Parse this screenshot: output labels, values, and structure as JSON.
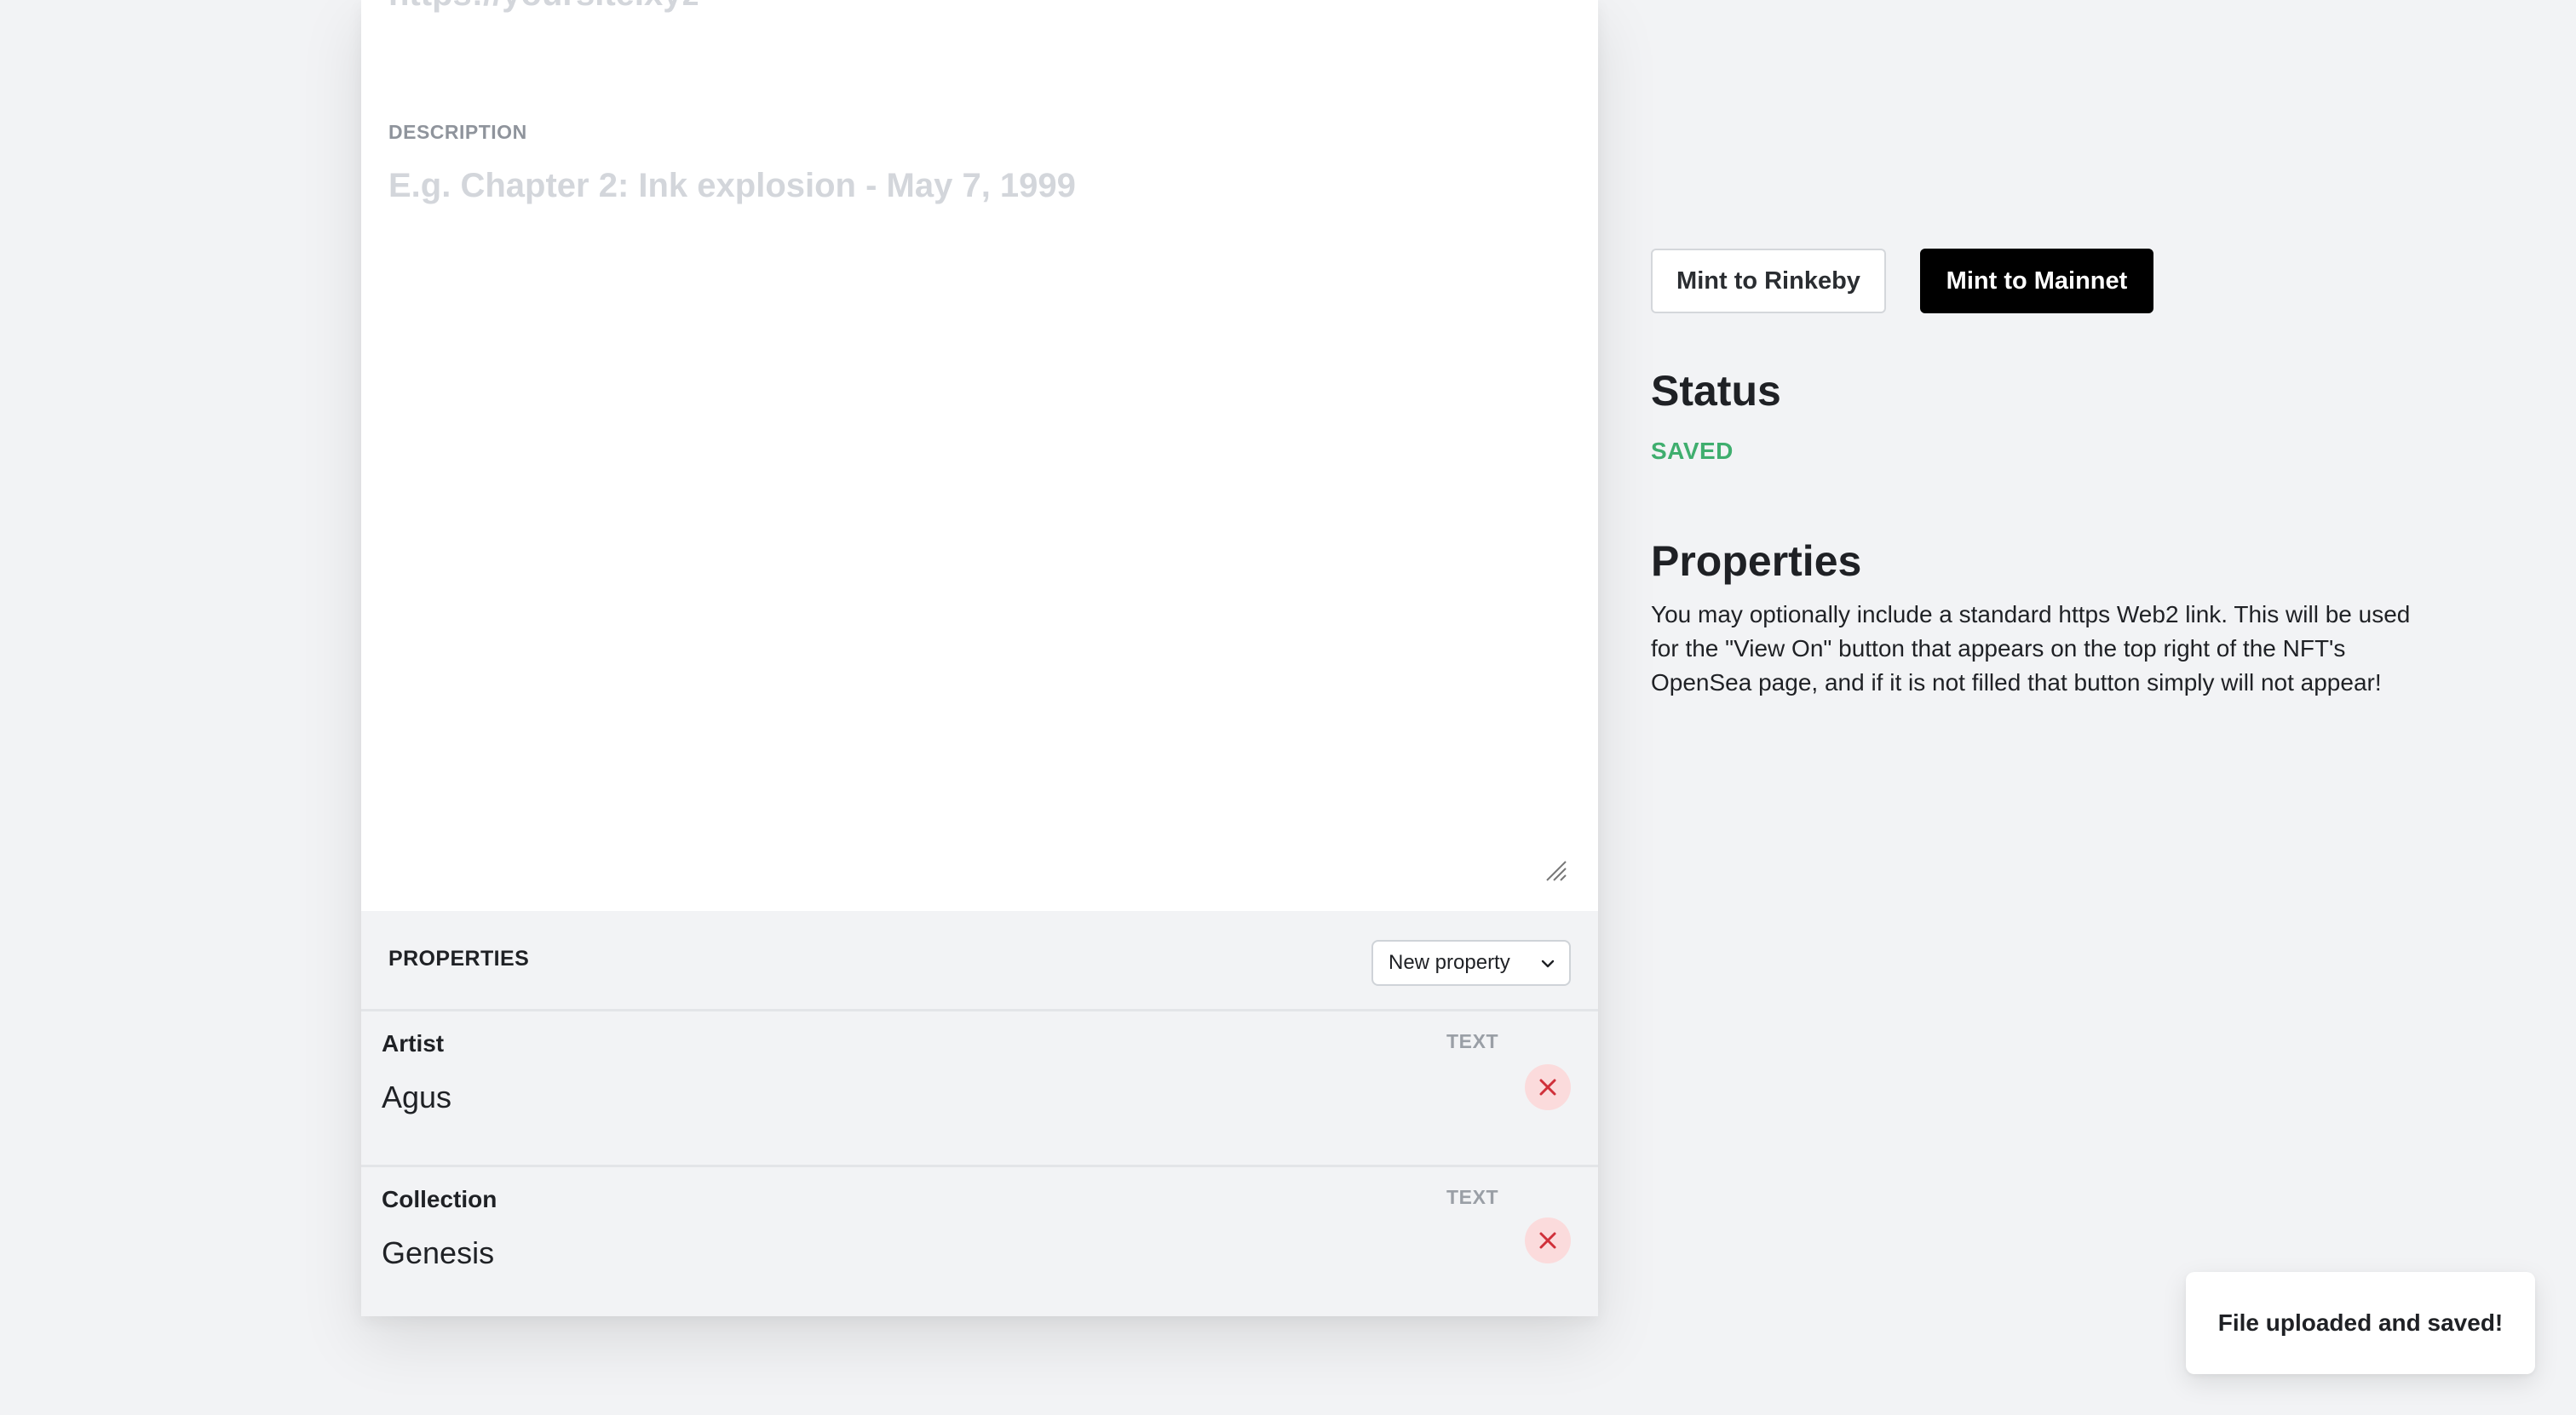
{
  "editor": {
    "url_placeholder": "https://yoursite.xyz",
    "description_label": "DESCRIPTION",
    "description_placeholder": "E.g. Chapter 2: Ink explosion - May 7, 1999",
    "description_value": "",
    "properties_title": "PROPERTIES",
    "new_property_label": "New property",
    "properties": [
      {
        "name": "Artist",
        "type": "TEXT",
        "value": "Agus"
      },
      {
        "name": "Collection",
        "type": "TEXT",
        "value": "Genesis"
      }
    ]
  },
  "sidebar": {
    "mint_rinkeby_label": "Mint to Rinkeby",
    "mint_mainnet_label": "Mint to Mainnet",
    "status_heading": "Status",
    "status_value": "SAVED",
    "properties_heading": "Properties",
    "properties_description": "You may optionally include a standard https Web2 link. This will be used for the \"View On\" button that appears on the top right of the NFT's OpenSea page, and if it is not filled that button simply will not appear!"
  },
  "toast": {
    "message": "File uploaded and saved!"
  },
  "colors": {
    "background": "#f2f3f5",
    "status_saved": "#3fae6e",
    "primary_button": "#000000",
    "remove_button_bg": "#fbdbdc",
    "remove_icon": "#d0303a"
  },
  "icons": {
    "dropdown": "chevron-down-icon",
    "remove": "close-icon",
    "resize": "resize-grip-icon"
  }
}
